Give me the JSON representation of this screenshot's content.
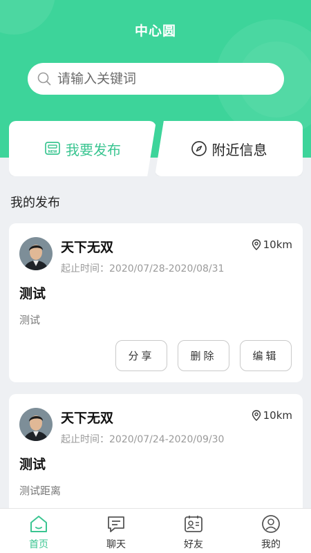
{
  "header": {
    "title": "中心圆"
  },
  "search": {
    "placeholder": "请输入关键词"
  },
  "actions": {
    "publish_label": "我要发布",
    "nearby_label": "附近信息"
  },
  "section_title": "我的发布",
  "posts": [
    {
      "username": "天下无双",
      "distance": "10km",
      "period": "起止时间：2020/07/28-2020/08/31",
      "title": "测试",
      "body": "测试",
      "buttons": {
        "share": "分享",
        "delete": "删除",
        "edit": "编辑"
      }
    },
    {
      "username": "天下无双",
      "distance": "10km",
      "period": "起止时间：2020/07/24-2020/09/30",
      "title": "测试",
      "body": "测试距离"
    }
  ],
  "tabbar": [
    {
      "label": "首页",
      "icon": "home-icon",
      "active": true
    },
    {
      "label": "聊天",
      "icon": "chat-icon",
      "active": false
    },
    {
      "label": "好友",
      "icon": "contacts-icon",
      "active": false
    },
    {
      "label": "我的",
      "icon": "user-icon",
      "active": false
    }
  ],
  "colors": {
    "accent": "#3dd49a",
    "accent_text": "#3ac591",
    "background": "#eef0f3"
  }
}
